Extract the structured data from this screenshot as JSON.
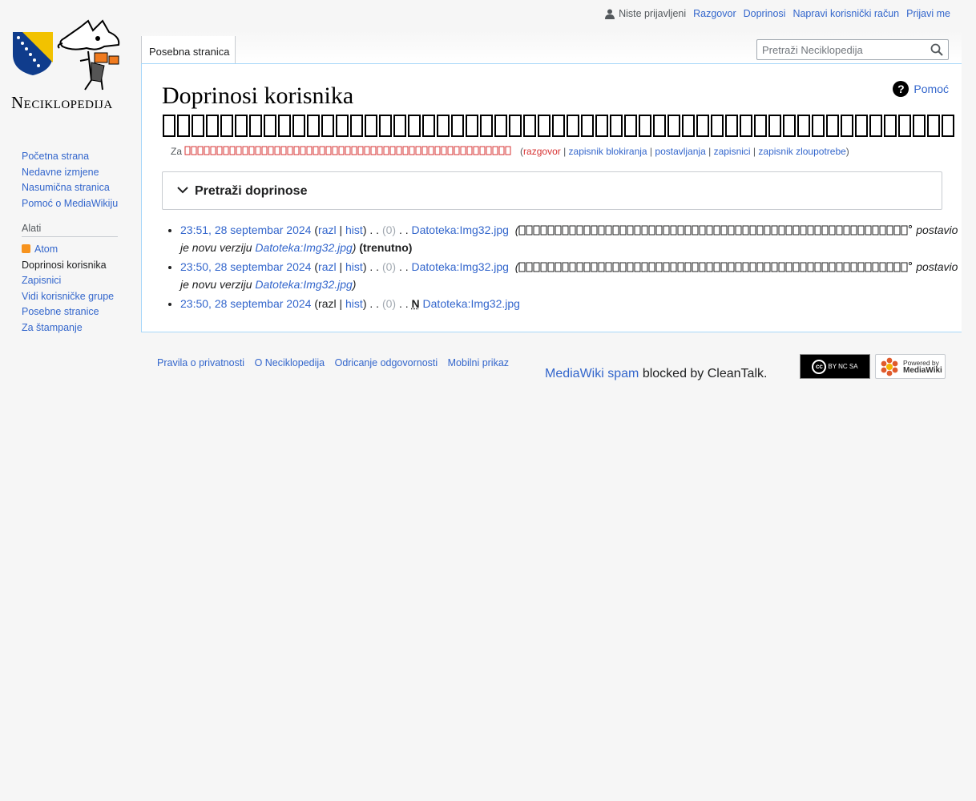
{
  "logo": {
    "wordmark": "Neciklopedija"
  },
  "personal_tools": {
    "anon": "Niste prijavljeni",
    "items": [
      "Razgovor",
      "Doprinosi",
      "Napravi korisnički račun",
      "Prijavi me"
    ]
  },
  "tabs": {
    "special": "Posebna stranica"
  },
  "search": {
    "placeholder": "Pretraži Neciklopedija"
  },
  "page": {
    "title": "Doprinosi korisnika",
    "title_username_boxes": "",
    "help": "Pomoć"
  },
  "subtitle": {
    "prefix": "Za",
    "username_boxes": "",
    "links": [
      "razgovor",
      "zapisnik blokiranja",
      "postavljanja",
      "zapisnici",
      "zapisnik zloupotrebe"
    ]
  },
  "search_box": {
    "title": "Pretraži doprinose"
  },
  "contributions": [
    {
      "timestamp": "23:51, 28 septembar 2024",
      "diff": "razl",
      "hist": "hist",
      "size": "(0)",
      "sep": ". .",
      "flag": "",
      "page": "Datoteka:Img32.jpg",
      "comment_user": "",
      "comment_text": "postavio je novu verziju",
      "comment_link": "Datoteka:Img32.jpg",
      "current": "(trenutno)"
    },
    {
      "timestamp": "23:50, 28 septembar 2024",
      "diff": "razl",
      "hist": "hist",
      "size": "(0)",
      "sep": ". .",
      "flag": "",
      "page": "Datoteka:Img32.jpg",
      "comment_user": "",
      "comment_text": "postavio je novu verziju",
      "comment_link": "Datoteka:Img32.jpg",
      "current": ""
    },
    {
      "timestamp": "23:50, 28 septembar 2024",
      "diff": "razl",
      "hist": "hist",
      "size": "(0)",
      "sep": ". .",
      "flag": "N",
      "page": "Datoteka:Img32.jpg",
      "comment_user": "",
      "comment_text": "",
      "comment_link": "",
      "current": ""
    }
  ],
  "sidebar": {
    "nav": [
      "Početna strana",
      "Nedavne izmjene",
      "Nasumična stranica",
      "Pomoć o MediaWikiju"
    ],
    "tools_title": "Alati",
    "tools": [
      "Atom",
      "Doprinosi korisnika",
      "Zapisnici",
      "Vidi korisničke grupe",
      "Posebne stranice",
      "Za štampanje"
    ]
  },
  "footer": {
    "links": [
      "Pravila o privatnosti",
      "O Neciklopedija",
      "Odricanje odgovornosti",
      "Mobilni prikaz"
    ],
    "cleantalk_link": "MediaWiki spam",
    "cleantalk_text": "blocked by CleanTalk.",
    "cc_label": "BY NC SA",
    "mw_label_1": "Powered by",
    "mw_label_2": "MediaWiki"
  },
  "colors": {
    "link": "#3366cc",
    "redlink": "#d73333",
    "border": "#a7d7f9",
    "background": "#f6f6f6"
  }
}
